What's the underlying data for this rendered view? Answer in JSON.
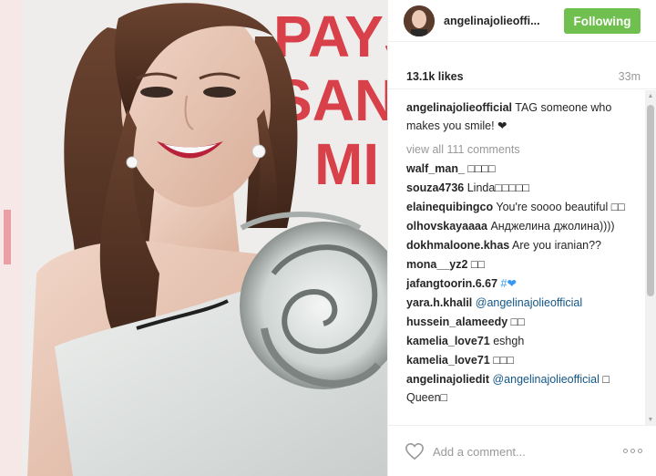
{
  "post": {
    "username": "angelinajolieoffi...",
    "follow_label": "Following",
    "likes": "13.1k likes",
    "time": "33m",
    "caption": {
      "user": "angelinajolieofficial",
      "text": "TAG someone who makes you smile! ❤"
    },
    "view_all": "view all 111 comments",
    "comments": [
      {
        "user": "walf_man_",
        "text": "□□□□"
      },
      {
        "user": "souza4736",
        "text": "Linda□□□□□"
      },
      {
        "user": "elainequibingco",
        "text": "You're soooo beautiful □□"
      },
      {
        "user": "olhovskayaaaa",
        "text": "Анджелина джолина))))"
      },
      {
        "user": "dokhmaloone.khas",
        "text": "Are you iranian??"
      },
      {
        "user": "mona__yz2",
        "text": "□□"
      },
      {
        "user": "jafangtoorin.6.67",
        "text": "#❤"
      },
      {
        "user": "yara.h.khalil",
        "mention": "@angelinajolieofficial"
      },
      {
        "user": "hussein_alameedy",
        "text": "□□"
      },
      {
        "user": "kamelia_love71",
        "text": "eshgh"
      },
      {
        "user": "kamelia_love71",
        "text": "□□□"
      },
      {
        "user": "angelinajoliedit",
        "mention": "@angelinajolieofficial",
        "text": "□ Queen□"
      }
    ],
    "comment_placeholder": "Add a comment...",
    "photo_text": [
      "PAYS",
      "SAN",
      "MI"
    ]
  },
  "icons": {
    "like": "heart-outline-icon",
    "more": "more-options-icon",
    "scroll_up": "scroll-up-arrow-icon",
    "scroll_down": "scroll-down-arrow-icon"
  },
  "colors": {
    "follow_green": "#70c050",
    "mention_blue": "#125688",
    "muted_gray": "#999999",
    "backdrop_red": "#d8404a"
  }
}
